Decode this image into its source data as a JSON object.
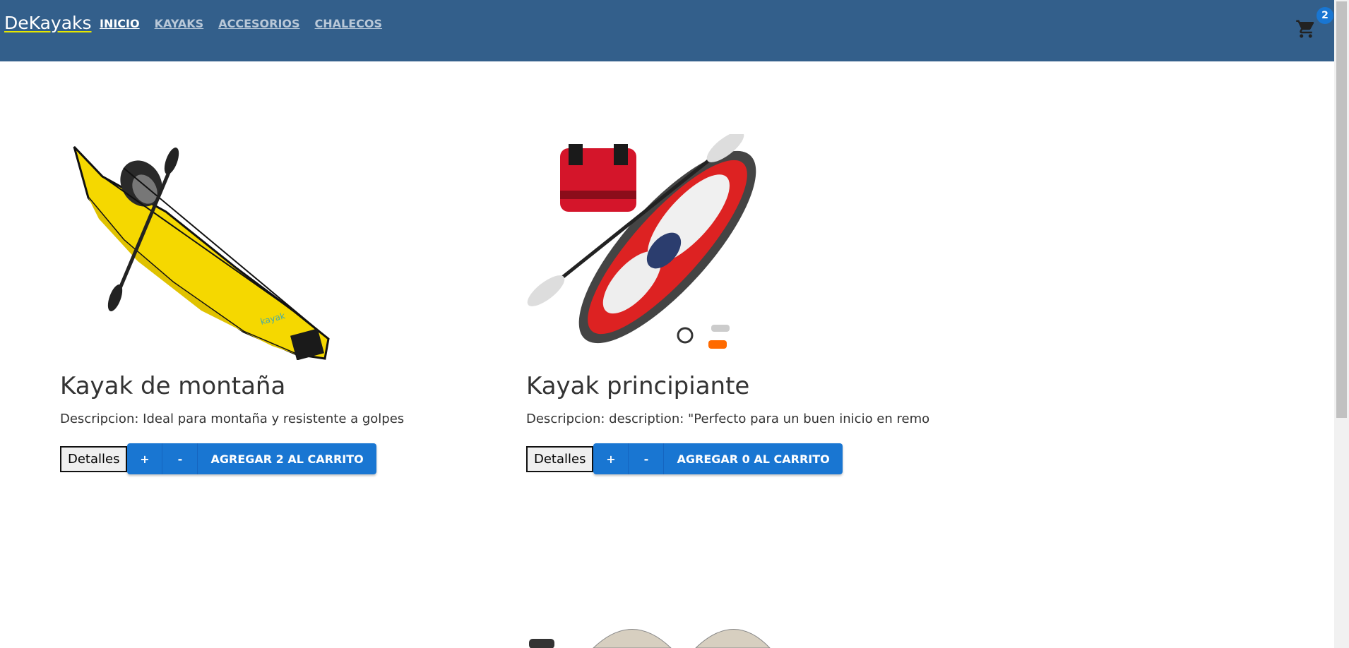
{
  "navbar": {
    "brand": "DeKayaks",
    "links": [
      {
        "label": "INICIO",
        "active": true
      },
      {
        "label": "KAYAKS",
        "active": false
      },
      {
        "label": "ACCESORIOS",
        "active": false
      },
      {
        "label": "CHALECOS",
        "active": false
      }
    ],
    "cart_icon": "shopping-cart-icon",
    "cart_count": "2"
  },
  "products": [
    {
      "title": "Kayak de montaña",
      "description": "Descripcion: Ideal para montaña y resistente a golpes",
      "details_label": "Detalles",
      "plus_label": "+",
      "minus_label": "-",
      "add_label": "AGREGAR 2 AL CARRITO"
    },
    {
      "title": "Kayak principiante",
      "description": "Descripcion: description: \"Perfecto para un buen inicio en remo",
      "details_label": "Detalles",
      "plus_label": "+",
      "minus_label": "-",
      "add_label": "AGREGAR 0 AL CARRITO"
    }
  ],
  "colors": {
    "navbar_bg": "#335f8b",
    "primary": "#1976d2",
    "text": "#333333"
  }
}
